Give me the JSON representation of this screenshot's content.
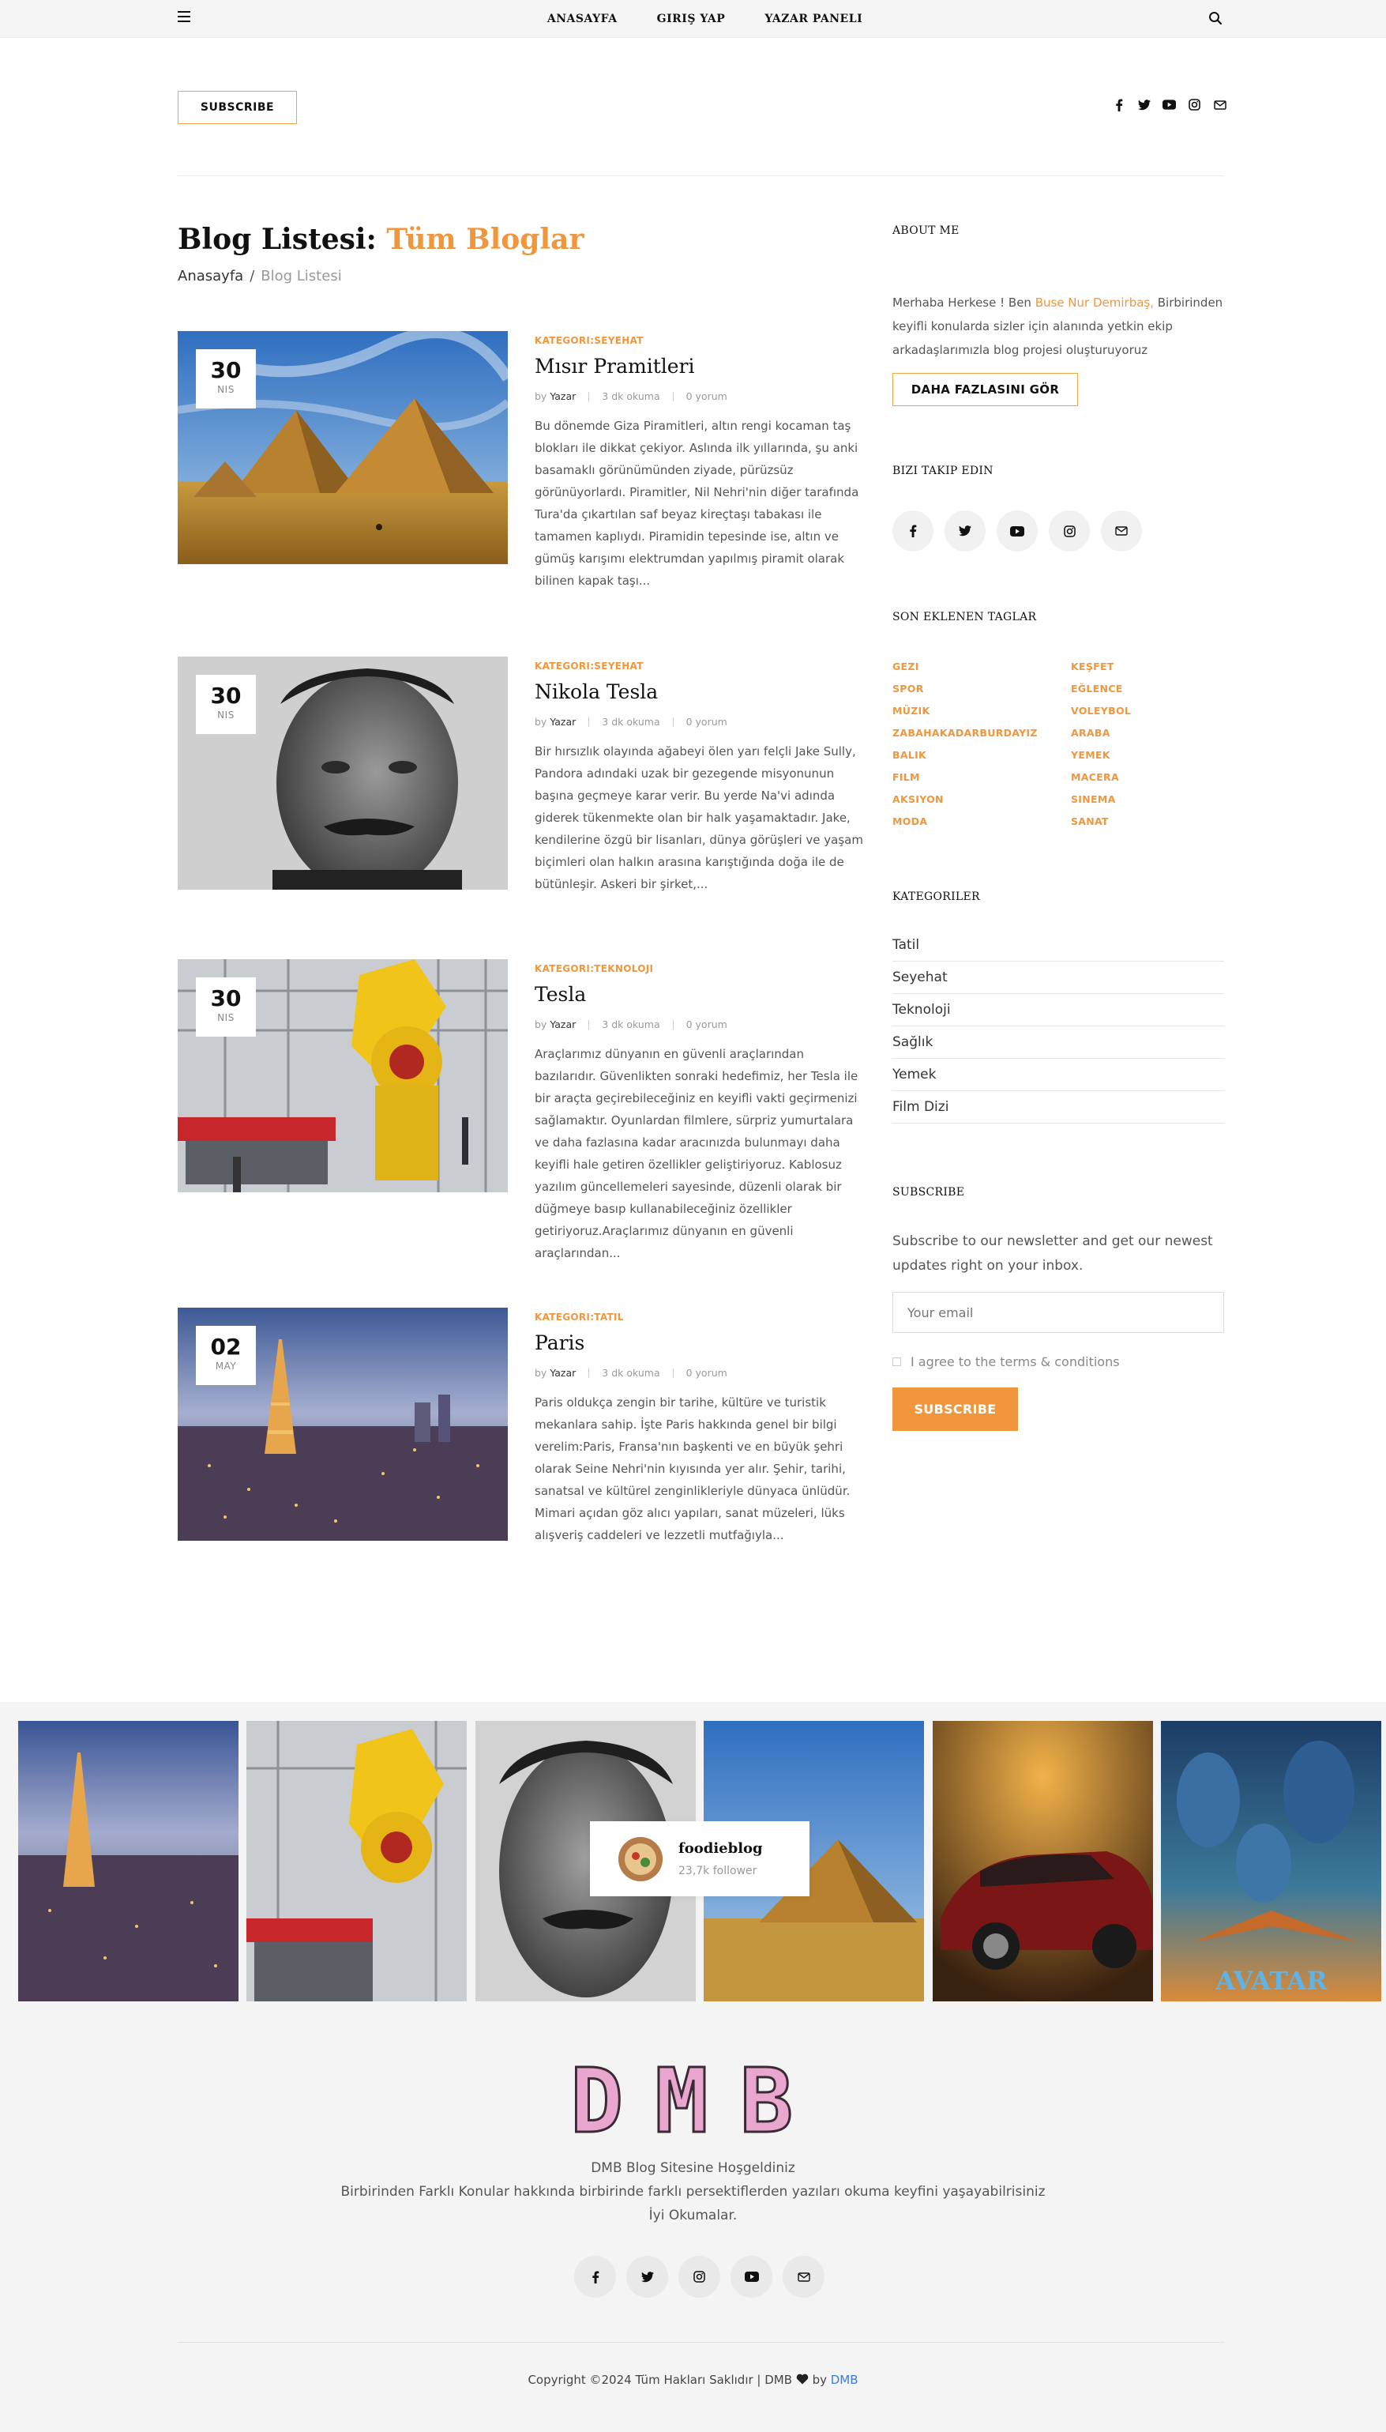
{
  "colors": {
    "accent": "#f0963c",
    "link": "#3b7dd8"
  },
  "nav": {
    "menu_icon": "hamburger-icon",
    "items": [
      "ANASAYFA",
      "GIRIŞ YAP",
      "YAZAR PANELI"
    ],
    "search_icon": "search-icon"
  },
  "header": {
    "subscribe_label": "SUBSCRIBE",
    "social_icons": [
      "facebook-icon",
      "twitter-icon",
      "youtube-icon",
      "instagram-icon",
      "mail-icon"
    ]
  },
  "page": {
    "title_prefix": "Blog Listesi: ",
    "title_accent": "Tüm Bloglar",
    "breadcrumb_home": "Anasayfa",
    "breadcrumb_sep": "/",
    "breadcrumb_current": "Blog Listesi"
  },
  "posts": [
    {
      "day": "30",
      "month": "NIS",
      "category": "KATEGORI:SEYEHAT",
      "title": "Mısır Pramitleri",
      "by": "by",
      "author": "Yazar",
      "read": "3 dk okuma",
      "comments": "0 yorum",
      "excerpt": "Bu dönemde Giza Piramitleri, altın rengi kocaman taş blokları ile dikkat çekiyor. Aslında ilk yıllarında, şu anki basamaklı görünümünden ziyade, pürüzsüz görünüyorlardı. Piramitler, Nil Nehri'nin diğer tarafında Tura'da çıkartılan saf beyaz kireçtaşı tabakası ile tamamen kaplıydı. Piramidin tepesinde ise, altın ve gümüş karışımı elektrumdan yapılmış piramit olarak bilinen kapak taşı..."
    },
    {
      "day": "30",
      "month": "NIS",
      "category": "KATEGORI:SEYEHAT",
      "title": "Nikola Tesla",
      "by": "by",
      "author": "Yazar",
      "read": "3 dk okuma",
      "comments": "0 yorum",
      "excerpt": "Bir hırsızlık olayında ağabeyi ölen yarı felçli Jake Sully, Pandora adındaki uzak bir gezegende misyonunun başına geçmeye karar verir. Bu yerde Na'vi adında giderek tükenmekte olan bir halk yaşamaktadır. Jake, kendilerine özgü bir lisanları, dünya görüşleri ve yaşam biçimleri olan halkın arasına karıştığında doğa ile de bütünleşir. Askeri bir şirket,..."
    },
    {
      "day": "30",
      "month": "NIS",
      "category": "KATEGORI:TEKNOLOJI",
      "title": "Tesla",
      "by": "by",
      "author": "Yazar",
      "read": "3 dk okuma",
      "comments": "0 yorum",
      "excerpt": "Araçlarımız dünyanın en güvenli araçlarından bazılarıdır. Güvenlikten sonraki hedefimiz, her Tesla ile bir araçta geçirebileceğiniz en keyifli vakti geçirmenizi sağlamaktır. Oyunlardan filmlere, sürpriz yumurtalara ve daha fazlasına kadar aracınızda bulunmayı daha keyifli hale getiren özellikler geliştiriyoruz. Kablosuz yazılım güncellemeleri sayesinde, düzenli olarak bir düğmeye basıp kullanabileceğiniz özellikler getiriyoruz.Araçlarımız dünyanın en güvenli araçlarından..."
    },
    {
      "day": "02",
      "month": "MAY",
      "category": "KATEGORI:TATIL",
      "title": "Paris",
      "by": "by",
      "author": "Yazar",
      "read": "3 dk okuma",
      "comments": "0 yorum",
      "excerpt": "Paris oldukça zengin bir tarihe, kültüre ve turistik mekanlara sahip. İşte Paris hakkında genel bir bilgi verelim:Paris, Fransa'nın başkenti ve en büyük şehri olarak Seine Nehri'nin kıyısında yer alır. Şehir, tarihi, sanatsal ve kültürel zenginlikleriyle dünyaca ünlüdür. Mimari açıdan göz alıcı yapıları, sanat müzeleri, lüks alışveriş caddeleri ve lezzetli mutfağıyla..."
    }
  ],
  "sidebar": {
    "about_heading": "ABOUT ME",
    "about_prefix": "Merhaba Herkese ! Ben ",
    "about_name": "Buse Nur Demirbaş,",
    "about_rest": " Birbirinden keyifli konularda sizler için alanında yetkin ekip arkadaşlarımızla blog projesi oluşturuyoruz",
    "more_label": "DAHA FAZLASINI GÖR",
    "follow_heading": "BIZI TAKIP EDIN",
    "follow_icons": [
      "facebook-icon",
      "twitter-icon",
      "youtube-icon",
      "instagram-icon",
      "mail-icon"
    ],
    "tags_heading": "SON EKLENEN TAGLAR",
    "tags": [
      "GEZI",
      "KEŞFET",
      "SPOR",
      "EĞLENCE",
      "MÜZIK",
      "VOLEYBOL",
      "ZABAHAKADARBURDAYIZ",
      "ARABA",
      "BALIK",
      "YEMEK",
      "FILM",
      "MACERA",
      "AKSIYON",
      "SINEMA",
      "MODA",
      "SANAT"
    ],
    "categories_heading": "KATEGORILER",
    "categories": [
      "Tatil",
      "Seyehat",
      "Teknoloji",
      "Sağlık",
      "Yemek",
      "Film Dizi"
    ],
    "subscribe_heading": "SUBSCRIBE",
    "subscribe_text": "Subscribe to our newsletter and get our newest updates right on your inbox.",
    "email_placeholder": "Your email",
    "agree_label": "I agree to the terms & conditions",
    "subscribe_button": "SUBSCRIBE"
  },
  "instagram": {
    "account": "foodieblog",
    "followers": "23,7k follower",
    "tile_subjects": [
      "paris",
      "robot-factory",
      "tesla-portrait",
      "pyramid",
      "red-car",
      "avatar-poster"
    ],
    "poster_caption": "AVATAR"
  },
  "footer": {
    "logo_text": "DMB",
    "welcome": "DMB Blog Sitesine Hoşgeldiniz",
    "line2": "Birbirinden Farklı Konular hakkında birbirinde farklı persektiflerden yazıları okuma keyfini yaşayabilrisiniz",
    "line3": "İyi Okumalar.",
    "social_icons": [
      "facebook-icon",
      "twitter-icon",
      "instagram-icon",
      "youtube-icon",
      "mail-icon"
    ],
    "copyright_prefix": "Copyright ©2024 Tüm Hakları Saklıdır | DMB ",
    "copyright_by": " by ",
    "copyright_brand": "DMB"
  }
}
